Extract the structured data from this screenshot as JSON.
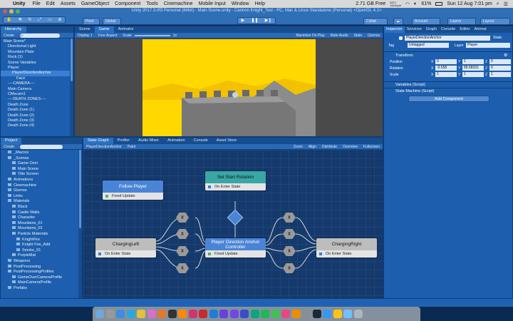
{
  "menubar": {
    "apple": "",
    "app": "Unity",
    "items": [
      "File",
      "Edit",
      "Assets",
      "GameObject",
      "Component",
      "Tools",
      "Cinemachine",
      "Mobile Input",
      "Window",
      "Help"
    ],
    "disk": "2.71 GB Free",
    "temp": "64°C\n1610rpm",
    "battery": "61%",
    "datetime": "Sun 12 Aug  7:01 pm"
  },
  "window": {
    "title": "Unity 2017.3.0f3 Personal (64bit) - Main Scene.unity - Cannon Knight_Test - PC, Mac & Linux Standalone (Personal) <OpenGL 4.1>"
  },
  "toolbar": {
    "pivot": "Pivot",
    "global": "Global",
    "collab": "Collab",
    "account": "Account",
    "layers": "Layers",
    "layout": "Layout"
  },
  "hierarchy": {
    "tab": "Hierarchy",
    "create": "Create",
    "search_placeholder": "All",
    "rows": [
      "Main Scene*",
      "Directional Light",
      "Mountain Plate",
      "Rock (1)",
      "Scene Variables",
      "Player",
      "PlayerDirectionAnchor",
      "Face",
      "----CAMERA----",
      "Main Camera",
      "CMvcam1",
      "----DEATH ZONES----",
      "Death Zone",
      "Death Zone (1)",
      "Death Zone (2)",
      "Death Zone (3)",
      "Death Zone (4)"
    ]
  },
  "scene": {
    "tabs": [
      "Scene",
      "Game",
      "Animator"
    ],
    "display": "Display 1",
    "aspect": "Free Aspect",
    "scale_label": "Scale",
    "scale_value": "1x",
    "buttons": [
      "Maximize On Play",
      "Mute Audio",
      "Stats",
      "Gizmos"
    ]
  },
  "inspector": {
    "tabs": [
      "Inspector",
      "Services",
      "Graph",
      "Console",
      "Editor",
      "Animat"
    ],
    "object_name": "PlayerDirectionAnchor",
    "static": "Static",
    "tag_label": "Tag",
    "tag_value": "Untagged",
    "layer_label": "Layer",
    "layer_value": "Player",
    "transform": {
      "title": "Transform",
      "position_label": "Position",
      "rotation_label": "Rotation",
      "scale_label": "Scale",
      "position": [
        "0",
        "1",
        "0"
      ],
      "rotation": [
        "-0.558",
        "89.68331",
        "0"
      ],
      "scale": [
        "1",
        "1",
        "1"
      ]
    },
    "components": [
      "Variables (Script)",
      "State Machine (Script)"
    ],
    "add_component": "Add Component"
  },
  "project": {
    "tab": "Project",
    "create": "Create",
    "rows": [
      "_Macros",
      "_Scenes",
      "Game Over",
      "Main Scene",
      "Title Screen",
      "Animations",
      "Cinemachine",
      "Gizmos",
      "Links",
      "Materials",
      "Black",
      "Castle Walls",
      "Character",
      "Mountains_01",
      "Mountains_02",
      "Particle Materials",
      "KnightFire",
      "Knight Fire_Add",
      "Smoke_01",
      "PurpleMat",
      "Weapons",
      "PostProcessing",
      "PostProcessingProfiles",
      "GameOverCameraProfile",
      "MainCameraProfile",
      "Prefabs"
    ]
  },
  "graph": {
    "tabs": [
      "State Graph",
      "Profiler",
      "Audio Mixer",
      "Animation",
      "Console",
      "Asset Store"
    ],
    "breadcrumb": "PlayerDirectionAnchor",
    "paint": "Paint",
    "toggles": [
      "Zoom",
      "Align",
      "Distribute",
      "Overview",
      "Fullscreen"
    ],
    "nodes": {
      "follow_player": {
        "title": "Follow Player",
        "body": "Fixed Update"
      },
      "set_start_rotation": {
        "title": "Set Start Rotation",
        "body": "On Enter State"
      },
      "charging_left": {
        "title": "ChargingLeft",
        "body": "On Enter State"
      },
      "anchor_controller": {
        "title": "Player Direction Anchor Controller",
        "body": "Fixed Update"
      },
      "charging_right": {
        "title": "ChargingRight",
        "body": "On Enter State"
      }
    },
    "colors": {
      "canvas": "#15396b",
      "grid": "#1d4479",
      "node_gray": "#bdbdbd",
      "node_blue": "#4a84d6",
      "node_teal": "#3aa6a6",
      "node_body": "#e4e4e4",
      "hex": "#9a9a9a",
      "hex_blue": "#4a84d6"
    }
  },
  "dock": {
    "icons": [
      "finder-icon",
      "launchpad-icon",
      "safari-icon",
      "skype-icon",
      "chrome-icon",
      "photos-icon",
      "firefox-icon",
      "unity-icon",
      "illustrator-icon",
      "indesign-icon",
      "acrobat-icon",
      "photoshop-icon",
      "aftereffects-icon",
      "premiere-icon",
      "media-encoder-icon",
      "audition-icon",
      "spotify-icon",
      "facetime-icon",
      "itunes-icon",
      "bridge-icon",
      "settings-icon",
      "steam-icon",
      "app-store-icon",
      "notes-icon",
      "download-icon",
      "trash-icon"
    ]
  }
}
